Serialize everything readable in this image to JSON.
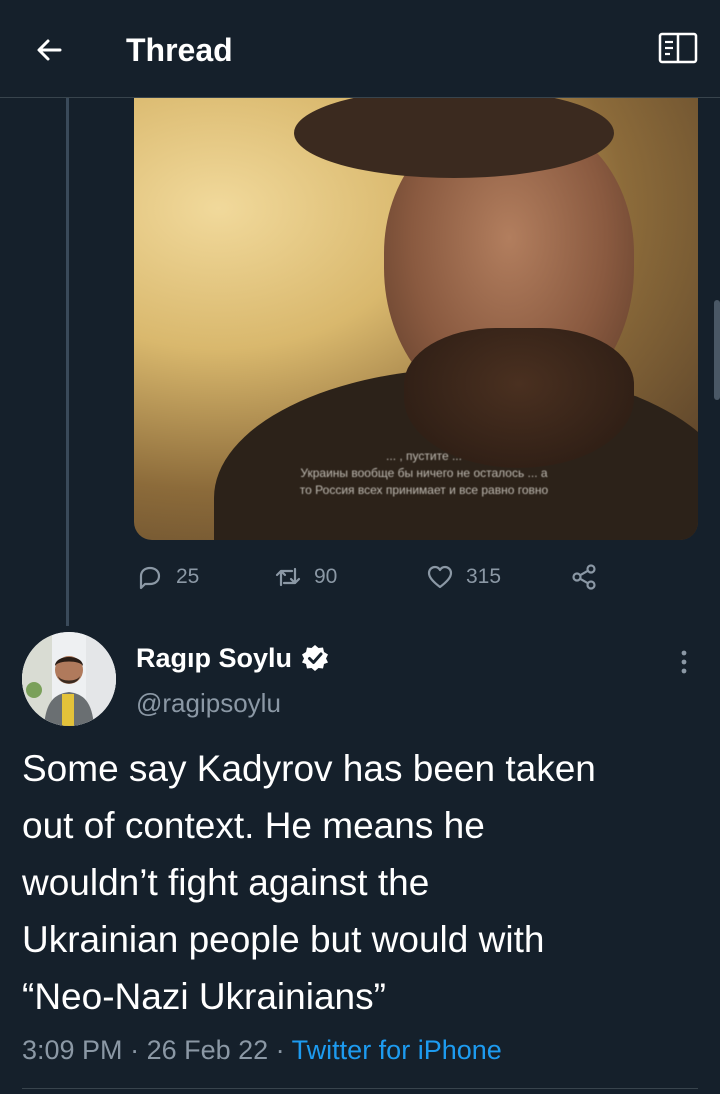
{
  "header": {
    "title": "Thread",
    "back_icon": "arrow-left-icon",
    "reader_icon": "open-book-icon"
  },
  "media": {
    "caption_lines": [
      "... , пустите ... ",
      "Украины вообще бы ничего не осталось ... а",
      "то Россия всех принимает и все равно говно"
    ]
  },
  "actions": {
    "reply_count": "25",
    "retweet_count": "90",
    "like_count": "315"
  },
  "tweet": {
    "author_name": "Ragıp Soylu",
    "author_handle": "@ragipsoylu",
    "text": "Some say Kadyrov has been taken\nout of context. He means he\nwouldn’t fight against the\nUkrainian people but would with\n“Neo-Nazi Ukrainians”",
    "time": "3:09 PM",
    "date": "26 Feb 22",
    "separator": " · ",
    "source": "Twitter for iPhone"
  },
  "colors": {
    "background": "#15202b",
    "accent": "#1d9bf0",
    "secondary_text": "#8b98a5"
  }
}
